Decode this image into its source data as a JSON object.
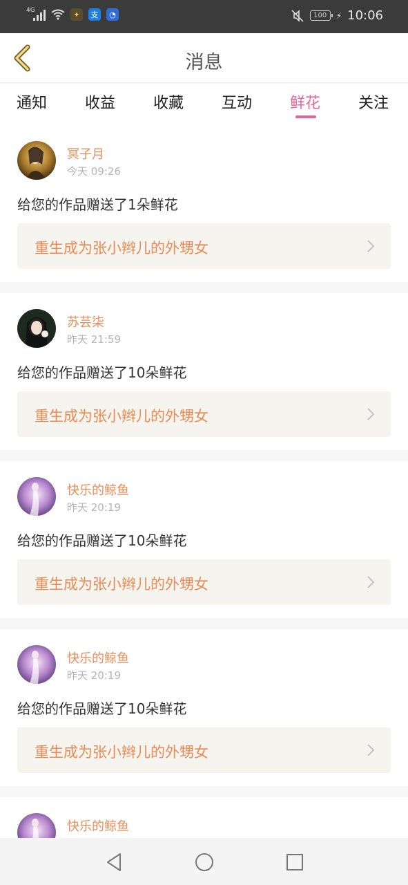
{
  "status": {
    "network": "4G",
    "battery": "100",
    "time": "10:06"
  },
  "header": {
    "title": "消息",
    "back_icon": "chevron-left-icon"
  },
  "tabs": [
    {
      "label": "通知",
      "active": false
    },
    {
      "label": "收益",
      "active": false
    },
    {
      "label": "收藏",
      "active": false
    },
    {
      "label": "互动",
      "active": false
    },
    {
      "label": "鲜花",
      "active": true
    },
    {
      "label": "关注",
      "active": false
    }
  ],
  "colors": {
    "accent": "#e2669a",
    "username": "#e88e5a",
    "link_text": "#ea8a55",
    "link_bg": "#f5f4ee"
  },
  "items": [
    {
      "user": "冥子月",
      "time": "今天 09:26",
      "message": "给您的作品赠送了1朵鲜花",
      "work": "重生成为张小辫儿的外甥女"
    },
    {
      "user": "苏芸柒",
      "time": "昨天 21:59",
      "message": "给您的作品赠送了10朵鲜花",
      "work": "重生成为张小辫儿的外甥女"
    },
    {
      "user": "快乐的鲸鱼",
      "time": "昨天 20:19",
      "message": "给您的作品赠送了10朵鲜花",
      "work": "重生成为张小辫儿的外甥女"
    },
    {
      "user": "快乐的鲸鱼",
      "time": "昨天 20:19",
      "message": "给您的作品赠送了10朵鲜花",
      "work": "重生成为张小辫儿的外甥女"
    },
    {
      "user": "快乐的鲸鱼",
      "time": "",
      "message": "",
      "work": ""
    }
  ],
  "nav": [
    "back-triangle-icon",
    "home-circle-icon",
    "recents-square-icon"
  ]
}
